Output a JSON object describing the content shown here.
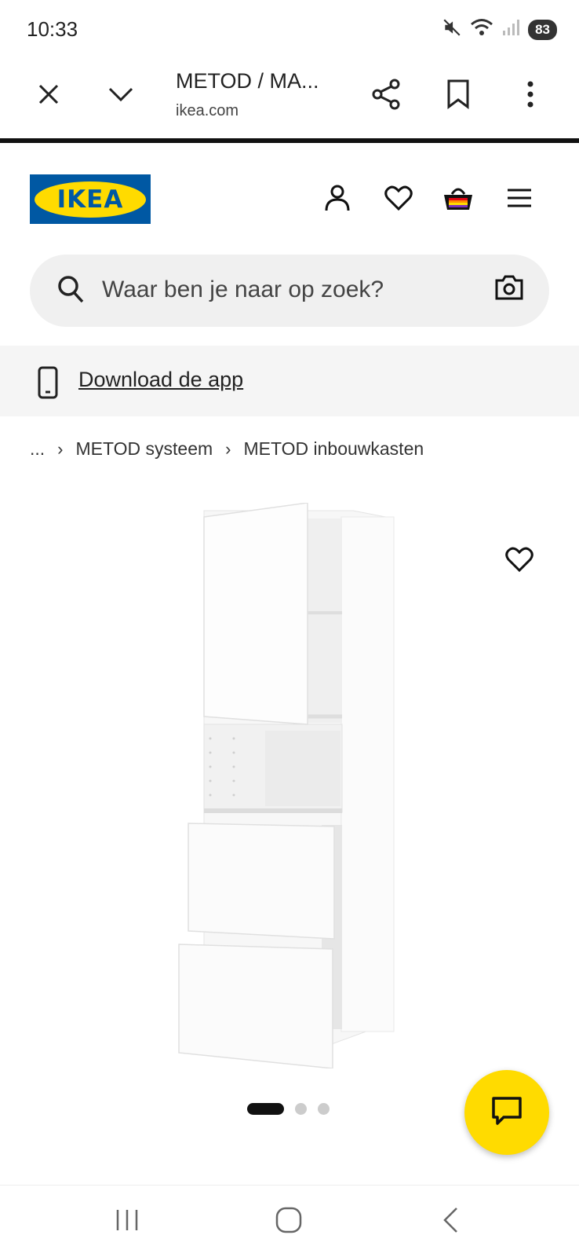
{
  "status_bar": {
    "time": "10:33",
    "battery": "83",
    "icons": [
      "mute-icon",
      "wifi-icon",
      "signal-icon"
    ]
  },
  "browser": {
    "title": "METOD / MA...",
    "host": "ikea.com",
    "icons": [
      "close-icon",
      "chevron-down-icon",
      "share-icon",
      "bookmark-icon",
      "more-icon"
    ]
  },
  "header": {
    "logo_text": "IKEA",
    "icons": [
      "account-icon",
      "heart-icon",
      "basket-icon",
      "menu-icon"
    ]
  },
  "search": {
    "placeholder": "Waar ben je naar op zoek?"
  },
  "app_banner": {
    "link": "Download de app"
  },
  "breadcrumb": {
    "ellipsis": "...",
    "items": [
      "METOD systeem",
      "METOD inbouwkasten"
    ]
  },
  "carousel": {
    "count": 3,
    "active": 1
  },
  "colors": {
    "ikea_blue": "#0058a3",
    "ikea_yellow": "#ffdb00"
  }
}
